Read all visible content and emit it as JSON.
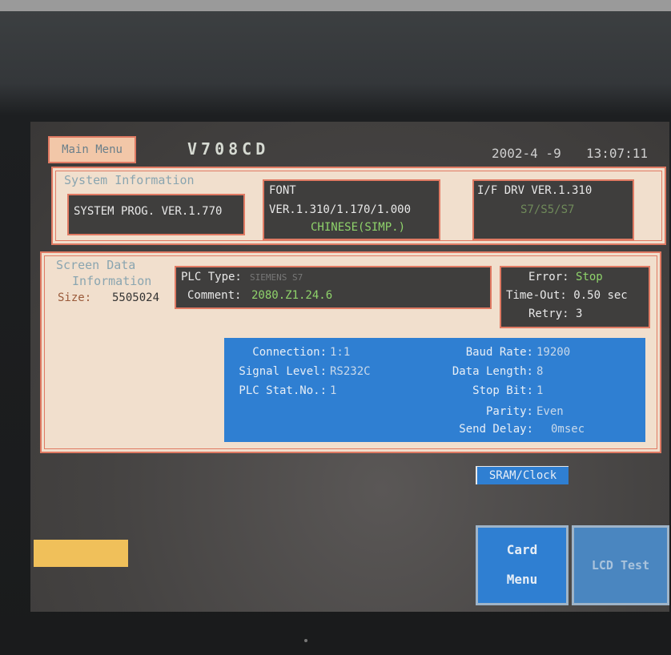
{
  "header": {
    "main_menu": "Main Menu",
    "model": "V708CD",
    "date": "2002-4 -9",
    "time": "13:07:11"
  },
  "system_info": {
    "heading": "System Information",
    "prog_version": "SYSTEM PROG. VER.1.770",
    "font_label": "FONT",
    "font_version": "VER.1.310/1.170/1.000",
    "font_language": "CHINESE(SIMP.)",
    "if_drv_version": "I/F DRV VER.1.310",
    "if_drv_sub": "S7/S5/S7"
  },
  "screen_data": {
    "heading_line1": "Screen Data",
    "heading_line2": "Information",
    "size_label": "Size:",
    "size_value": "5505024",
    "plc_type_label": "PLC Type:",
    "plc_type_value": "SIEMENS S7",
    "comment_label": "Comment:",
    "comment_value": "2080.Z1.24.6",
    "error_label": "Error:",
    "error_value": "Stop",
    "timeout_label": "Time-Out:",
    "timeout_value": "0.50",
    "timeout_unit": "sec",
    "retry_label": "Retry:",
    "retry_value": "3"
  },
  "communication": {
    "connection_label": "Connection:",
    "connection_value": "1:1",
    "signal_label": "Signal Level:",
    "signal_value": "RS232C",
    "plc_stat_label": "PLC Stat.No.:",
    "plc_stat_value": "1",
    "baud_label": "Baud Rate:",
    "baud_value": "19200",
    "data_length_label": "Data Length:",
    "data_length_value": "8",
    "stop_bit_label": "Stop Bit:",
    "stop_bit_value": "1",
    "parity_label": "Parity:",
    "parity_value": "Even",
    "send_delay_label": "Send Delay:",
    "send_delay_value": "0msec"
  },
  "buttons": {
    "sram_clock": "SRAM/Clock",
    "card_line1": "Card",
    "card_line2": "Menu",
    "lcd_test": "LCD Test"
  },
  "colors": {
    "panel": "#f1dfcd",
    "border": "#e07a63",
    "blue": "#2f7fd2",
    "green_text": "#8fd36b",
    "yellow": "#f0c05a"
  }
}
